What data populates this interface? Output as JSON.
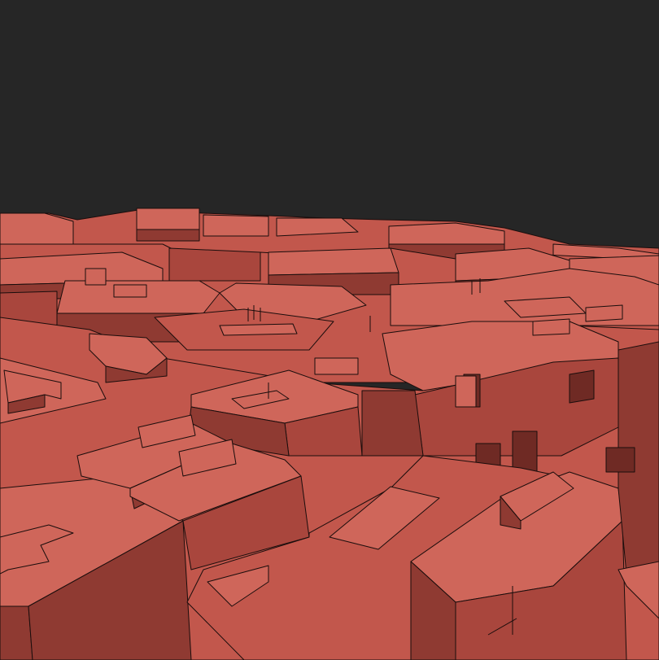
{
  "scene": {
    "description_kind": "3d-viewport-render",
    "background_color": "#262626",
    "mesh_color": "#c2574c",
    "mesh_shadow_color": "#8f3a32",
    "edge_color": "#1a0d0c",
    "subject_icon": "city-blocks-icon"
  }
}
